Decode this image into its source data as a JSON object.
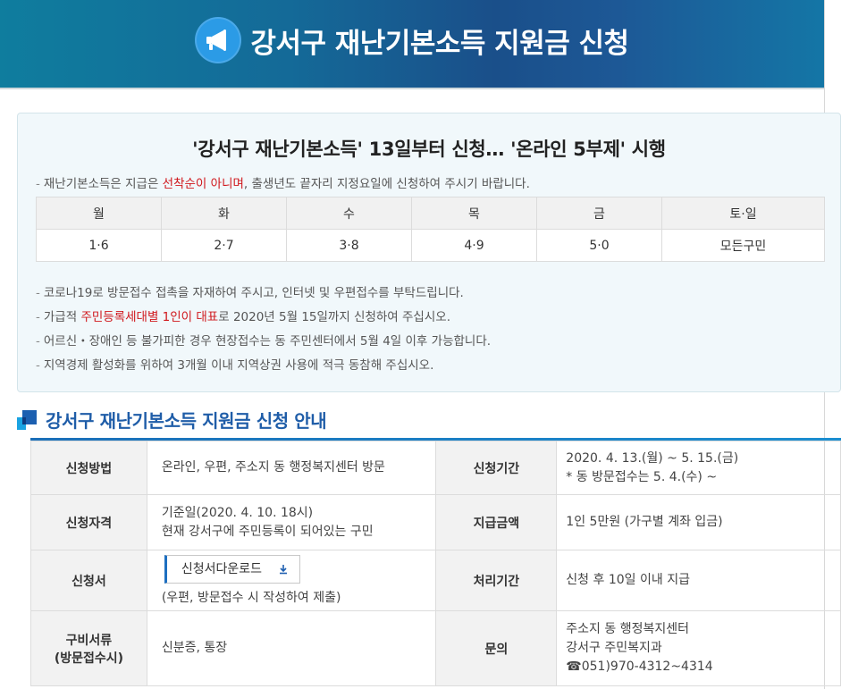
{
  "banner": {
    "title": "강서구 재난기본소득 지원금 신청"
  },
  "notice": {
    "title": "'강서구 재난기본소득' 13일부터 신청… '온라인 5부제' 시행",
    "intro_a": "재난기본소득은 지급은 ",
    "intro_red": "선착순이 아니며",
    "intro_b": ", 출생년도 끝자리 지정요일에 신청하여 주시기 바랍니다.",
    "days": {
      "headers": [
        "월",
        "화",
        "수",
        "목",
        "금",
        "토·일"
      ],
      "values": [
        "1·6",
        "2·7",
        "3·8",
        "4·9",
        "5·0",
        "모든구민"
      ]
    },
    "line1": "코로나19로 방문접수 접촉을 자재하여 주시고, 인터넷 및 우편접수를 부탁드립니다.",
    "line2_a": "가급적 ",
    "line2_red": "주민등록세대별 1인이 대표",
    "line2_b": "로 2020년 5월 15일까지 신청하여 주십시오.",
    "line3": "어르신・장애인 등 불가피한 경우 현장접수는 동 주민센터에서 5월 4일 이후 가능합니다.",
    "line4": "지역경제 활성화를 위하여 3개월 이내 지역상권 사용에 적극 동참해 주십시오."
  },
  "guide": {
    "title": "강서구 재난기본소득 지원금 신청 안내",
    "method_label": "신청방법",
    "method_value": "온라인, 우편, 주소지 동 행정복지센터 방문",
    "period_label": "신청기간",
    "period_value1": "2020. 4. 13.(월) ~ 5. 15.(금)",
    "period_value2": "* 동 방문접수는 5. 4.(수) ~",
    "qual_label": "신청자격",
    "qual_value1": "기준일(2020. 4. 10. 18시)",
    "qual_value2": "현재 강서구에 주민등록이 되어있는 구민",
    "amount_label": "지급금액",
    "amount_value": "1인 5만원 (가구별 계좌 입금)",
    "form_label": "신청서",
    "download_label": "신청서다운로드",
    "form_note": "(우편, 방문접수 시 작성하여 제출)",
    "process_label": "처리기간",
    "process_value": "신청 후 10일 이내 지급",
    "docs_label1": "구비서류",
    "docs_label2": "(방문접수시)",
    "docs_value": "신분증, 통장",
    "contact_label": "문의",
    "contact_value1": "주소지 동 행정복지센터",
    "contact_value2": "강서구 주민복지과",
    "contact_value3": "☎051)970-4312~4314"
  },
  "colors": {
    "banner": "#146a98",
    "accent": "#1f5da8",
    "highlight": "#d0171c"
  },
  "icons": {
    "banner": "megaphone-icon",
    "section": "section-square-icon",
    "download": "download-icon"
  }
}
